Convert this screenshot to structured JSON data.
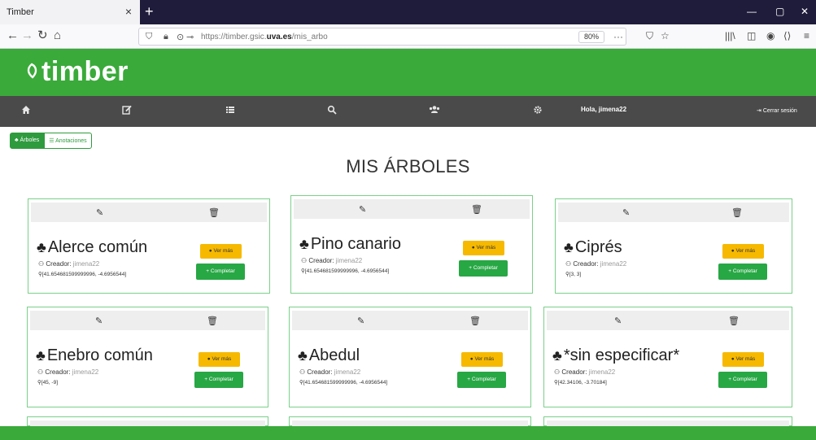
{
  "browser": {
    "tab_title": "Timber",
    "tab_close": "×",
    "new_tab": "+",
    "url_prefix": "https://timber.gsic.",
    "url_domain": "uva.es",
    "url_suffix": "/mis_arbo",
    "zoom": "80%",
    "more": "···"
  },
  "site": {
    "logo_text": "timber",
    "greeting": "Hola, jimena22",
    "logout": "Cerrar sesión"
  },
  "toggle": {
    "trees_label": "Árboles",
    "annotations_label": "Anotaciones"
  },
  "page_title": "MIS ÁRBOLES",
  "cards": [
    {
      "name": "Alerce común",
      "creator_label": "Creador:",
      "creator": "jimena22",
      "coords": "[41.654681599999996, -4.6956544]",
      "more_label": "Ver más",
      "complete_label": "Completar"
    },
    {
      "name": "Pino canario",
      "creator_label": "Creador:",
      "creator": "jimena22",
      "coords": "[41.654681599999996, -4.6956544]",
      "more_label": "Ver más",
      "complete_label": "Completar"
    },
    {
      "name": "Ciprés",
      "creator_label": "Creador:",
      "creator": "jimena22",
      "coords": "[3, 3]",
      "more_label": "Ver más",
      "complete_label": "Completar"
    },
    {
      "name": "Enebro común",
      "creator_label": "Creador:",
      "creator": "jimena22",
      "coords": "[45, -9]",
      "more_label": "Ver más",
      "complete_label": "Completar"
    },
    {
      "name": "Abedul",
      "creator_label": "Creador:",
      "creator": "jimena22",
      "coords": "[41.654681599999996, -4.6956544]",
      "more_label": "Ver más",
      "complete_label": "Completar"
    },
    {
      "name": "*sin especificar*",
      "creator_label": "Creador:",
      "creator": "jimena22",
      "coords": "[42.34106, -3.70184]",
      "more_label": "Ver más",
      "complete_label": "Completar"
    }
  ],
  "colors": {
    "brand_green": "#3aaa3a",
    "menu_bg": "#4a4a4a",
    "ver_mas": "#f6b900",
    "completar": "#28a745"
  },
  "icons": [
    "home-icon",
    "edit-icon",
    "list-icon",
    "search-icon",
    "users-icon",
    "gear-icon",
    "tree-icon",
    "trash-icon",
    "user-icon",
    "map-marker-icon",
    "eye-icon",
    "plus-icon",
    "logout-icon"
  ]
}
